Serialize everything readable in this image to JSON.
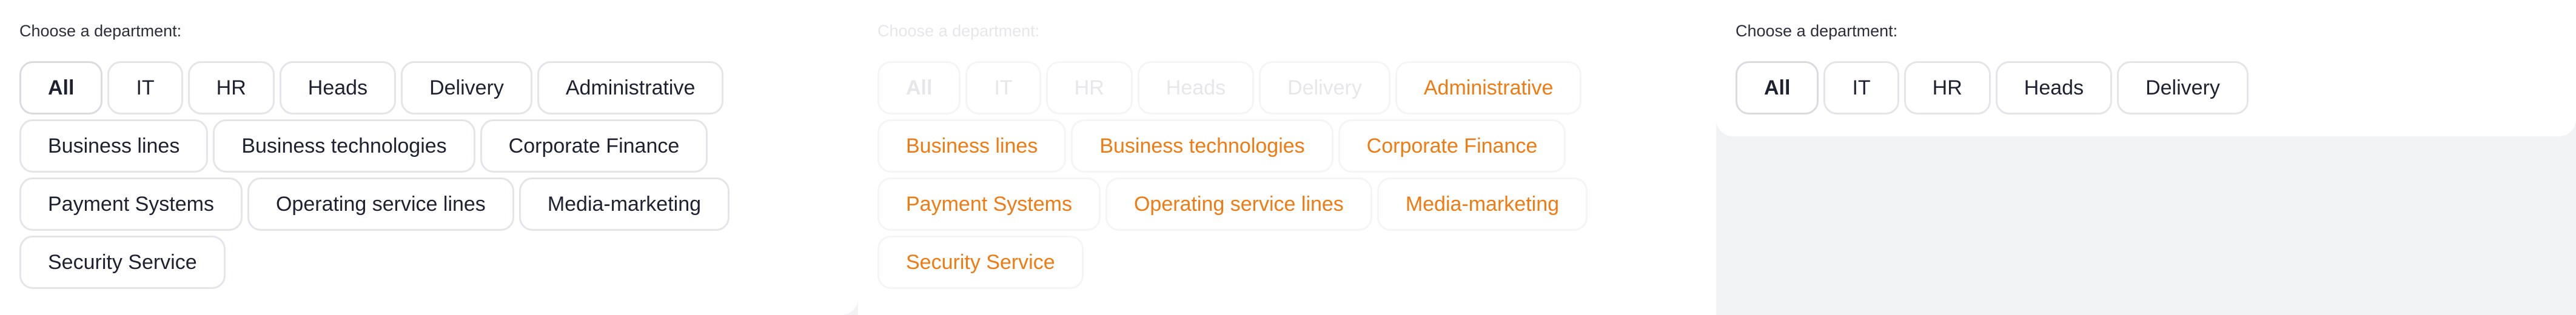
{
  "panels": [
    {
      "label": "Choose a department:",
      "chips": [
        "All",
        "IT",
        "HR",
        "Heads",
        "Delivery",
        "Administrative",
        "Business lines",
        "Business technologies",
        "Corporate Finance",
        "Payment Systems",
        "Operating service lines",
        "Media-marketing",
        "Security Service"
      ]
    },
    {
      "label": "Choose a department:",
      "chips": [
        "All",
        "IT",
        "HR",
        "Heads",
        "Delivery",
        "Administrative",
        "Business lines",
        "Business technologies",
        "Corporate Finance",
        "Payment Systems",
        "Operating service lines",
        "Media-marketing",
        "Security Service"
      ]
    },
    {
      "label": "Choose a department:",
      "chips": [
        "All",
        "IT",
        "HR",
        "Heads",
        "Delivery"
      ]
    }
  ],
  "colors": {
    "highlight": "#f07b13",
    "text": "#1d2130",
    "border": "#e3e5ea"
  }
}
